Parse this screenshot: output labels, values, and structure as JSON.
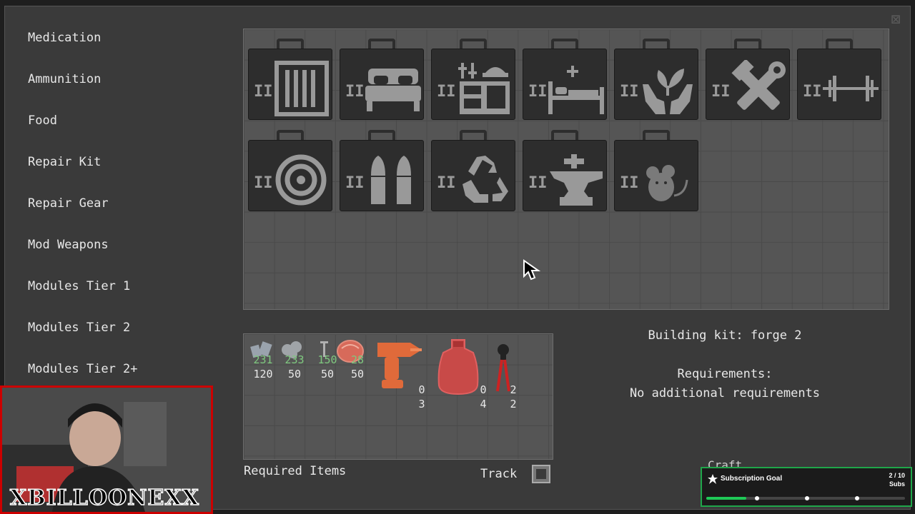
{
  "sidebar": {
    "items": [
      {
        "label": "Medication"
      },
      {
        "label": "Ammunition"
      },
      {
        "label": "Food"
      },
      {
        "label": "Repair Kit"
      },
      {
        "label": "Repair Gear"
      },
      {
        "label": "Mod Weapons"
      },
      {
        "label": "Modules Tier 1"
      },
      {
        "label": "Modules Tier 2"
      },
      {
        "label": "Modules Tier 2+"
      }
    ]
  },
  "kits": [
    {
      "tier": "II",
      "icon": "storage-crate-icon"
    },
    {
      "tier": "II",
      "icon": "bed-icon"
    },
    {
      "tier": "II",
      "icon": "workbench-icon"
    },
    {
      "tier": "II",
      "icon": "medical-bed-icon"
    },
    {
      "tier": "II",
      "icon": "plant-hands-icon"
    },
    {
      "tier": "II",
      "icon": "hammer-wrench-icon"
    },
    {
      "tier": "II",
      "icon": "dumbbell-icon"
    },
    {
      "tier": "II",
      "icon": "target-icon"
    },
    {
      "tier": "II",
      "icon": "bullets-icon"
    },
    {
      "tier": "II",
      "icon": "recycle-icon"
    },
    {
      "tier": "II",
      "icon": "anvil-icon"
    },
    {
      "tier": "II",
      "icon": "mouse-icon"
    }
  ],
  "required_items": [
    {
      "icon": "scrap-metal-icon",
      "have": "231",
      "need": "120"
    },
    {
      "icon": "stone-icon",
      "have": "233",
      "need": "50"
    },
    {
      "icon": "nails-icon",
      "have": "150",
      "need": "50"
    },
    {
      "icon": "raw-meat-icon",
      "have": "28",
      "need": "50"
    },
    {
      "icon": "power-drill-icon",
      "have": "0",
      "need": "3"
    },
    {
      "icon": "gas-bag-icon",
      "have": "0",
      "need": "4"
    },
    {
      "icon": "pliers-icon",
      "have": "2",
      "need": "2"
    }
  ],
  "labels": {
    "required_items": "Required Items",
    "track": "Track",
    "craft": "Craft"
  },
  "info": {
    "title": "Building kit: forge 2",
    "requirements_label": "Requirements:",
    "requirements_value": "No additional requirements"
  },
  "overlay": {
    "streamer_name": "XBILLOONEXX",
    "goal_title": "Subscription Goal",
    "goal_count": "2 / 10",
    "goal_unit": "Subs",
    "goal_progress": 0.2
  },
  "colors": {
    "accent_green": "#1fc957",
    "have_ok": "#7fc97f",
    "missing_item_tint": "#e06a4a",
    "webcam_border": "#cc0000"
  }
}
